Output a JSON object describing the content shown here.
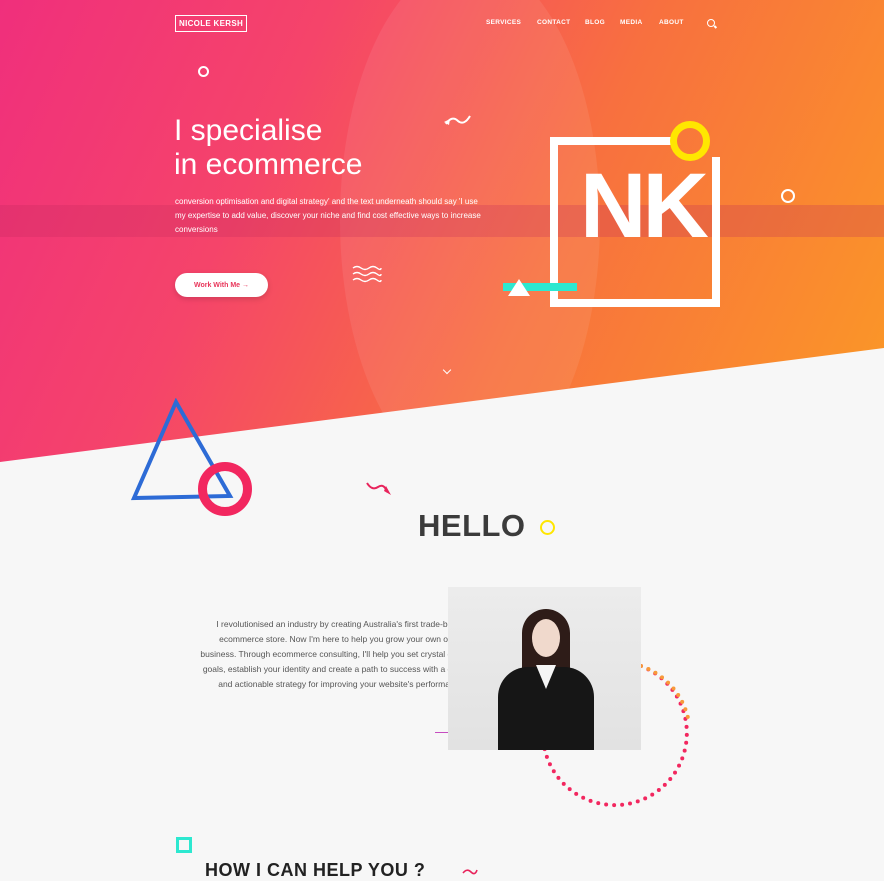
{
  "header": {
    "logo": "NICOLE KERSH",
    "nav": [
      "SERVICES",
      "CONTACT",
      "BLOG",
      "MEDIA",
      "ABOUT"
    ]
  },
  "hero": {
    "headline_line1": "I specialise",
    "headline_line2": "in ecommerce",
    "subtext": "conversion optimisation and digital strategy' and the text underneath should say 'I use my expertise to add value, discover your niche and find cost effective ways to increase conversions",
    "cta": "Work With Me",
    "cta_arrow": "→",
    "monogram": "NK"
  },
  "about": {
    "title": "HELLO",
    "bio": "I revolutionised an industry by creating Australia's first trade-based ecommerce store. Now I'm here to help you grow your own online business. Through ecommerce consulting, I'll help you set crystal clear goals, establish your identity and create a path to success with a clear and actionable strategy for improving your website's performance."
  },
  "services": {
    "title": "HOW I CAN HELP YOU ?"
  },
  "colors": {
    "gradient_pink": "#f02f7c",
    "gradient_orange": "#fb9a25",
    "accent_yellow": "#ffe600",
    "accent_teal": "#2de8d0",
    "accent_blue": "#2d6bd6",
    "accent_red": "#f2275f",
    "dot_orange": "#f79a3a"
  },
  "icons": [
    "search-icon",
    "arrow-right-icon",
    "chevron-down-icon"
  ]
}
